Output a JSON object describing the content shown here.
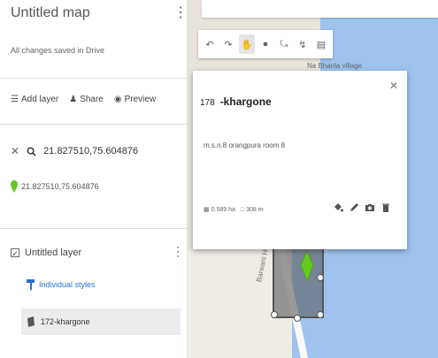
{
  "panel": {
    "map_title": "Untitled map",
    "saved_status": "All changes saved in Drive",
    "actions": {
      "add_layer": "Add layer",
      "share": "Share",
      "preview": "Preview"
    },
    "search": {
      "value": "21.827510,75.604876"
    },
    "result": {
      "label": "21.827510,75.604876"
    },
    "layer": {
      "name": "Untitled layer",
      "style_link": "Individual styles",
      "feature_label": "172-khargone"
    }
  },
  "map": {
    "road_label": "Barwani Hwy",
    "place_label": "Na Bhanla village"
  },
  "info_card": {
    "number": "178",
    "title": "-khargone",
    "description": "m.s.n.8 orangpura room 8",
    "area": "0.589 ha",
    "perimeter": "308 m"
  },
  "colors": {
    "pin_green": "#65c91f",
    "link_blue": "#2d6fd6",
    "water": "#9ec3ef"
  }
}
